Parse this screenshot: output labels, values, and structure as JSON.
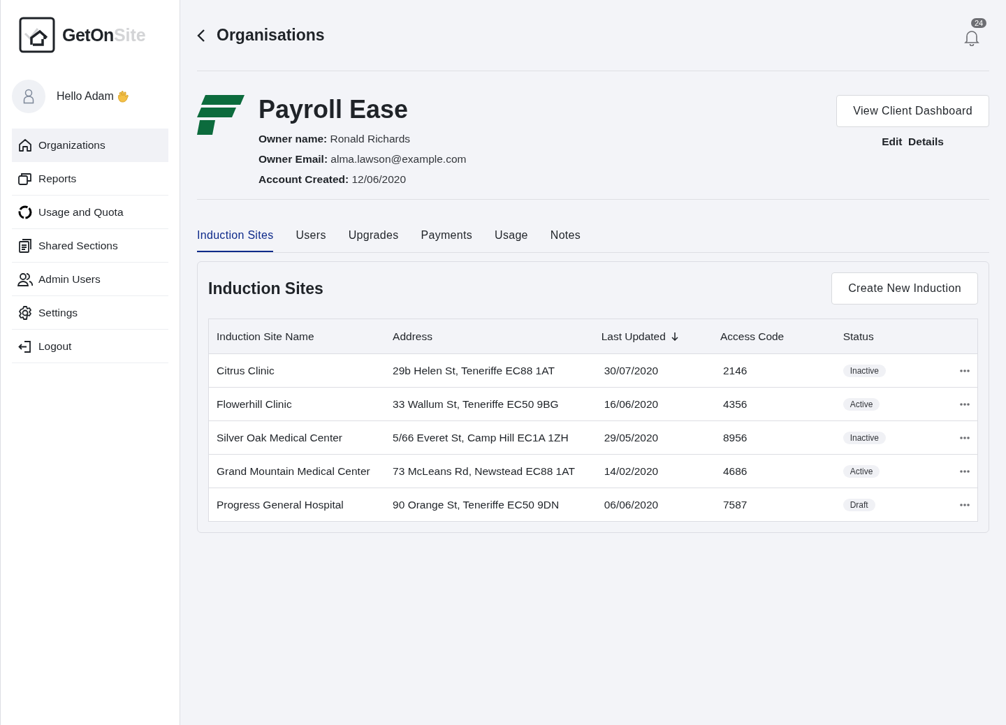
{
  "sidebar": {
    "logo": {
      "primary": "GetOn",
      "secondary": "Site"
    },
    "greeting": "Hello Adam",
    "items": [
      {
        "label": "Organizations",
        "selected": true
      },
      {
        "label": "Reports",
        "selected": false
      },
      {
        "label": "Usage and Quota",
        "selected": false
      },
      {
        "label": "Shared Sections",
        "selected": false
      },
      {
        "label": "Admin Users",
        "selected": false
      },
      {
        "label": "Settings",
        "selected": false
      },
      {
        "label": "Logout",
        "selected": false
      }
    ]
  },
  "header": {
    "title": "Organisations",
    "notifications": "24"
  },
  "organisation": {
    "name": "Payroll Ease",
    "details": [
      "**Owner name:** Ronald Richards",
      "**Owner Email:** alma.lawson@example.com",
      "**Account Created:** 12/06/2020"
    ],
    "primary_action": "View Client Dashboard",
    "secondary_action": "Edit  Details"
  },
  "tabs": [
    {
      "label": "Induction Sites",
      "selected": true
    },
    {
      "label": "Users",
      "selected": false
    },
    {
      "label": "Upgrades",
      "selected": false
    },
    {
      "label": "Payments",
      "selected": false
    },
    {
      "label": "Usage",
      "selected": false
    },
    {
      "label": "Notes",
      "selected": false
    }
  ],
  "panel": {
    "title": "Induction Sites",
    "action": "Create New Induction",
    "table": {
      "columns": [
        {
          "label": "Induction Site Name",
          "sorted": false
        },
        {
          "label": "Address",
          "sorted": false
        },
        {
          "label": "Last Updated",
          "sorted": true
        },
        {
          "label": "Access Code",
          "sorted": false
        },
        {
          "label": "Status",
          "sorted": false
        }
      ],
      "rows": [
        {
          "name": "Citrus Clinic",
          "address": "29b Helen St, Teneriffe EC88 1AT",
          "updated": "30/07/2020",
          "code": "2146",
          "status": "Inactive"
        },
        {
          "name": "Flowerhill Clinic",
          "address": "33 Wallum St, Teneriffe EC50 9BG",
          "updated": "16/06/2020",
          "code": "4356",
          "status": "Active"
        },
        {
          "name": "Silver Oak Medical Center",
          "address": "5/66 Everet St, Camp Hill EC1A 1ZH",
          "updated": "29/05/2020",
          "code": "8956",
          "status": "Inactive"
        },
        {
          "name": "Grand Mountain Medical Center",
          "address": "73 McLeans Rd, Newstead EC88 1AT",
          "updated": "14/02/2020",
          "code": "4686",
          "status": "Active"
        },
        {
          "name": "Progress General Hospital",
          "address": "90 Orange St, Teneriffe EC50 9DN",
          "updated": "06/06/2020",
          "code": "7587",
          "status": "Draft"
        }
      ]
    }
  }
}
